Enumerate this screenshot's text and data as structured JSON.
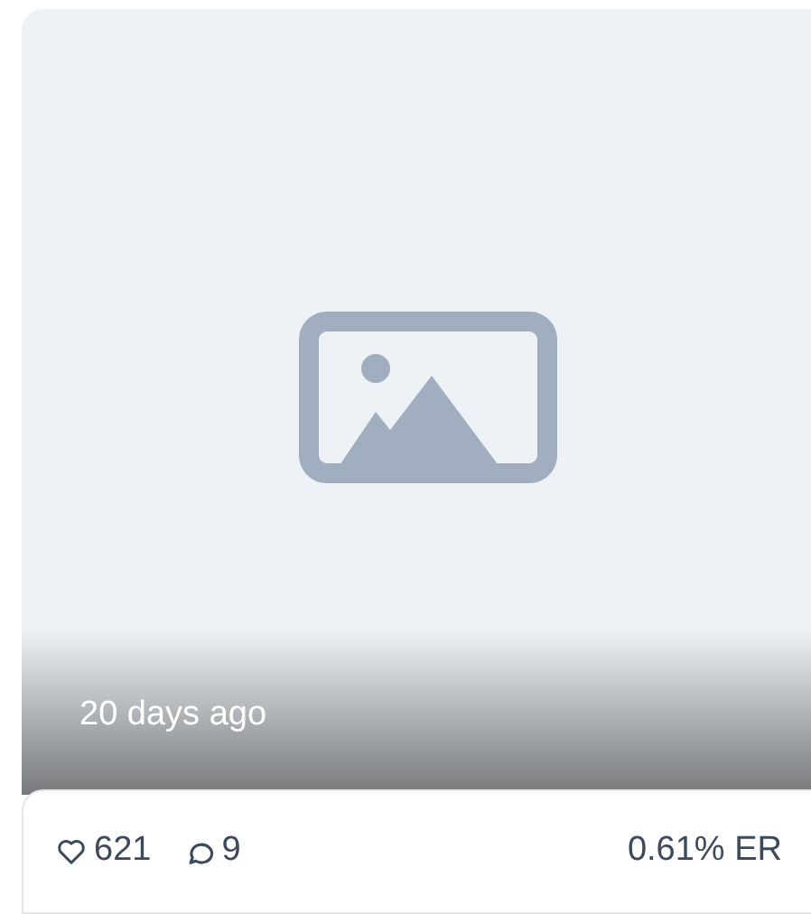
{
  "post": {
    "time": "20 days ago",
    "likes": "621",
    "comments": "9",
    "engagement": "0.61% ER"
  }
}
